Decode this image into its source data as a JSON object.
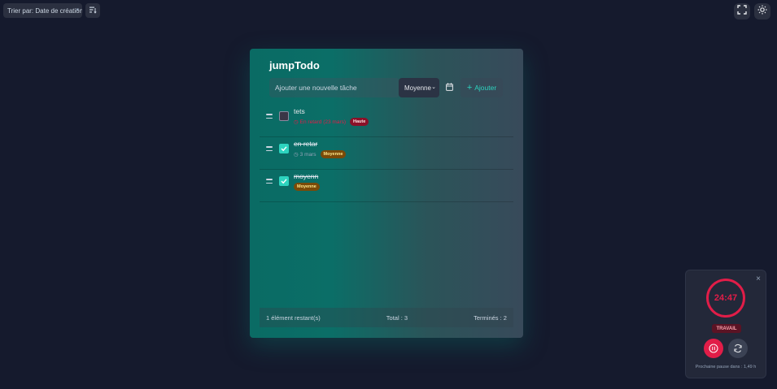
{
  "toolbar": {
    "sort_label": "Trier par: Date de création",
    "sort_button_icon": "sort-icon",
    "fullscreen_icon": "fullscreen-icon",
    "theme_icon": "sun-icon"
  },
  "app": {
    "title": "jumpTodo",
    "input_placeholder": "Ajouter une nouvelle tâche",
    "priority_selected": "Moyenne",
    "add_label": "Ajouter",
    "accent_color": "#2dd4bf"
  },
  "tasks": [
    {
      "title": "tets",
      "done": false,
      "due": "En retard (23 mars)",
      "late": true,
      "priority": "Haute"
    },
    {
      "title": "en retar",
      "done": true,
      "due": "3 mars",
      "late": false,
      "priority": "Moyenne"
    },
    {
      "title": "moyenn",
      "done": true,
      "due": "",
      "late": false,
      "priority": "Moyenne"
    }
  ],
  "footer": {
    "remaining": "1 élément restant(s)",
    "total": "Total : 3",
    "completed": "Terminés : 2"
  },
  "pomodoro": {
    "time": "24:47",
    "mode": "TRAVAIL",
    "next_break": "Prochaine pause dans : 1,49 h",
    "accent_color": "#e11d48"
  }
}
